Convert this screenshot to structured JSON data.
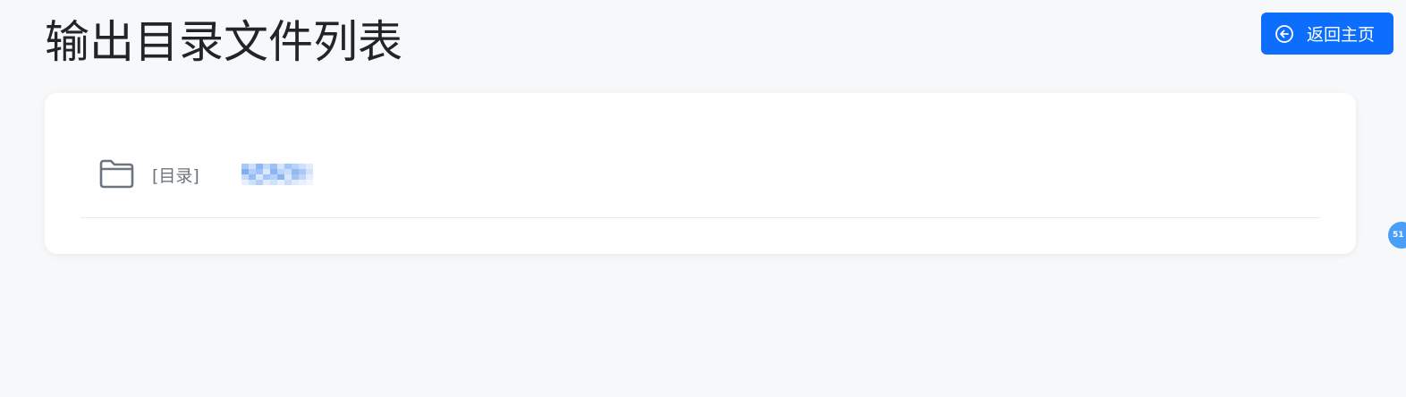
{
  "page": {
    "title": "输出目录文件列表"
  },
  "header": {
    "home_button_label": "返回主页",
    "home_button_icon": "arrow-left-circle-icon"
  },
  "file_list": {
    "items": [
      {
        "icon": "folder-icon",
        "type_label": "[目录]",
        "name": "",
        "name_obscured": true
      }
    ]
  },
  "side_badge": {
    "text": "51"
  },
  "colors": {
    "primary": "#0d6efd",
    "background": "#f7f8fa",
    "card": "#ffffff",
    "muted_text": "#6c757d",
    "badge": "#4a9df8"
  }
}
